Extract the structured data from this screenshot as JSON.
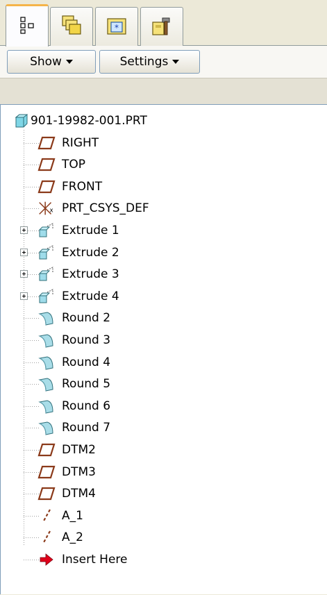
{
  "tabs": [
    {
      "name": "model-tree-icon",
      "active": true
    },
    {
      "name": "layers-icon",
      "active": false
    },
    {
      "name": "folder-browser-icon",
      "active": false
    },
    {
      "name": "tools-icon",
      "active": false
    }
  ],
  "toolbar": {
    "show_label": "Show",
    "settings_label": "Settings"
  },
  "tree": {
    "root": {
      "label": "901-19982-001.PRT",
      "icon": "part-icon"
    },
    "items": [
      {
        "label": "RIGHT",
        "icon": "datum-plane-icon",
        "expandable": false
      },
      {
        "label": "TOP",
        "icon": "datum-plane-icon",
        "expandable": false
      },
      {
        "label": "FRONT",
        "icon": "datum-plane-icon",
        "expandable": false
      },
      {
        "label": "PRT_CSYS_DEF",
        "icon": "coordinate-system-icon",
        "expandable": false
      },
      {
        "label": "Extrude 1",
        "icon": "extrude-icon",
        "expandable": true
      },
      {
        "label": "Extrude 2",
        "icon": "extrude-icon",
        "expandable": true
      },
      {
        "label": "Extrude 3",
        "icon": "extrude-icon",
        "expandable": true
      },
      {
        "label": "Extrude 4",
        "icon": "extrude-icon",
        "expandable": true
      },
      {
        "label": "Round 2",
        "icon": "round-icon",
        "expandable": false
      },
      {
        "label": "Round 3",
        "icon": "round-icon",
        "expandable": false
      },
      {
        "label": "Round 4",
        "icon": "round-icon",
        "expandable": false
      },
      {
        "label": "Round 5",
        "icon": "round-icon",
        "expandable": false
      },
      {
        "label": "Round 6",
        "icon": "round-icon",
        "expandable": false
      },
      {
        "label": "Round 7",
        "icon": "round-icon",
        "expandable": false
      },
      {
        "label": "DTM2",
        "icon": "datum-plane-icon",
        "expandable": false
      },
      {
        "label": "DTM3",
        "icon": "datum-plane-icon",
        "expandable": false
      },
      {
        "label": "DTM4",
        "icon": "datum-plane-icon",
        "expandable": false
      },
      {
        "label": "A_1",
        "icon": "datum-axis-icon",
        "expandable": false
      },
      {
        "label": "A_2",
        "icon": "datum-axis-icon",
        "expandable": false
      },
      {
        "label": "Insert Here",
        "icon": "insert-here-arrow-icon",
        "expandable": false
      }
    ]
  },
  "colors": {
    "datum_plane": "#8b3a1a",
    "part": "#7fd6e6",
    "insert_arrow": "#e0001a",
    "tab_accent": "#f5b44a"
  }
}
